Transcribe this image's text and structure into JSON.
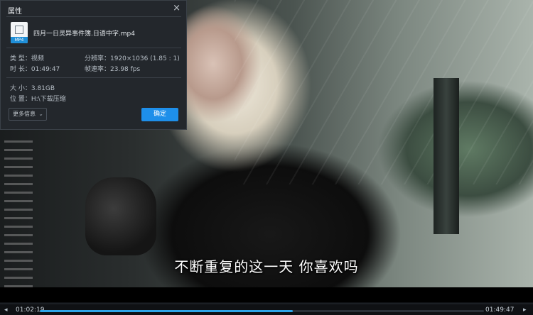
{
  "video": {
    "subtitle": "不断重复的这一天 你喜欢吗"
  },
  "player": {
    "current_time": "01:02:19",
    "total_time": "01:49:47",
    "progress_fraction": 0.57,
    "skip_back_icon": "◂",
    "skip_forward_icon": "▸",
    "accent_color": "#2da5e8"
  },
  "dialog": {
    "title": "属性",
    "close_icon": "×",
    "file_icon_badge": "MP4",
    "file_name": "四月一日灵异事件簿.日语中字.mp4",
    "type": "类  型：视频",
    "resolution": "分辨率：1920×1036 (1.85 : 1)",
    "duration": "时  长：01:49:47",
    "frame_rate": "帧速率：23.98 fps",
    "size": "大  小：3.81GB",
    "location": "位  置：H:\\下载压缩",
    "more_info_label": "更多信息",
    "more_info_chevron": "⌄",
    "ok_label": "确定",
    "ok_color": "#1e8fea"
  }
}
